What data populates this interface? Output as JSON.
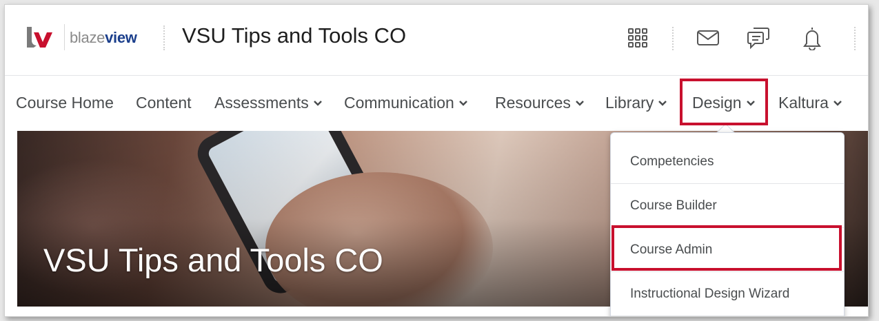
{
  "header": {
    "logo_brand_light": "blaze",
    "logo_brand_bold": "view",
    "course_title": "VSU Tips and Tools CO",
    "icons": [
      "grid-icon",
      "mail-icon",
      "chat-icon",
      "bell-icon"
    ]
  },
  "nav": {
    "items": [
      {
        "label": "Course Home",
        "has_menu": false
      },
      {
        "label": "Content",
        "has_menu": false
      },
      {
        "label": "Assessments",
        "has_menu": true
      },
      {
        "label": "Communication",
        "has_menu": true
      },
      {
        "label": "Resources",
        "has_menu": true
      },
      {
        "label": "Library",
        "has_menu": true
      },
      {
        "label": "Design",
        "has_menu": true,
        "highlighted": true
      },
      {
        "label": "Kaltura",
        "has_menu": true
      }
    ]
  },
  "hero": {
    "title": "VSU Tips and Tools CO"
  },
  "design_menu": {
    "items": [
      {
        "label": "Competencies"
      },
      {
        "label": "Course Builder"
      },
      {
        "label": "Course Admin",
        "highlighted": true
      },
      {
        "label": "Instructional Design Wizard"
      }
    ]
  },
  "colors": {
    "highlight": "#c8102e",
    "brand_blue": "#1b3f8c",
    "text": "#494c4e"
  }
}
